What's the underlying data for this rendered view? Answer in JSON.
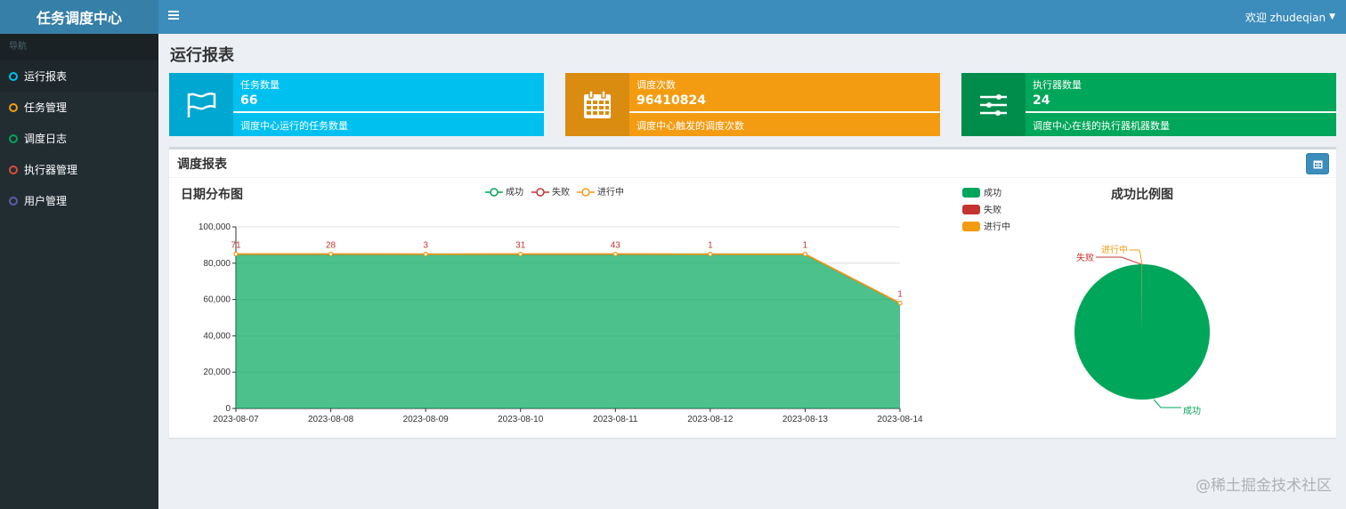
{
  "header": {
    "brand": "任务调度中心",
    "user": "欢迎 zhudeqian"
  },
  "sidebar": {
    "header": "导航",
    "items": [
      {
        "label": "运行报表",
        "color": "#00c0ef"
      },
      {
        "label": "任务管理",
        "color": "#f39c12"
      },
      {
        "label": "调度日志",
        "color": "#00a65a"
      },
      {
        "label": "执行器管理",
        "color": "#dd4b39"
      },
      {
        "label": "用户管理",
        "color": "#605ca8"
      }
    ]
  },
  "page": {
    "title": "运行报表"
  },
  "info_boxes": [
    {
      "title": "任务数量",
      "number": "66",
      "desc": "调度中心运行的任务数量",
      "color": "#00c0ef",
      "icon_bg": "#00a7d0",
      "icon": "flag-icon"
    },
    {
      "title": "调度次数",
      "number": "96410824",
      "desc": "调度中心触发的调度次数",
      "color": "#f39c12",
      "icon_bg": "#da8c10",
      "icon": "calendar-icon"
    },
    {
      "title": "执行器数量",
      "number": "24",
      "desc": "调度中心在线的执行器机器数量",
      "color": "#00a65a",
      "icon_bg": "#008d4c",
      "icon": "sliders-icon"
    }
  ],
  "report": {
    "title": "调度报表"
  },
  "line_chart": {
    "title": "日期分布图",
    "legend": [
      "成功",
      "失败",
      "进行中"
    ]
  },
  "pie_chart": {
    "title": "成功比例图",
    "legend": [
      "成功",
      "失败",
      "进行中"
    ]
  },
  "chart_data": [
    {
      "type": "area",
      "title": "日期分布图",
      "categories": [
        "2023-08-07",
        "2023-08-08",
        "2023-08-09",
        "2023-08-10",
        "2023-08-11",
        "2023-08-12",
        "2023-08-13",
        "2023-08-14"
      ],
      "y_ticks": [
        "0",
        "20,000",
        "40,000",
        "60,000",
        "80,000",
        "100,000"
      ],
      "ylim": [
        0,
        100000
      ],
      "stacked": true,
      "series": [
        {
          "name": "成功",
          "color": "#00a65a",
          "values": [
            85000,
            85000,
            85000,
            85000,
            85000,
            85000,
            85000,
            58000
          ]
        },
        {
          "name": "失败",
          "color": "#c23531",
          "values": [
            71,
            28,
            3,
            31,
            43,
            1,
            1,
            1
          ]
        },
        {
          "name": "进行中",
          "color": "#f39c12",
          "values": [
            0,
            0,
            0,
            0,
            0,
            0,
            0,
            0
          ]
        }
      ],
      "legend_position": "top"
    },
    {
      "type": "pie",
      "title": "成功比例图",
      "labels": [
        "成功",
        "失败",
        "进行中"
      ],
      "values": [
        99.9,
        0.05,
        0.05
      ],
      "colors": [
        "#00a65a",
        "#c23531",
        "#f39c12"
      ],
      "legend_position": "left"
    }
  ],
  "watermark": "@稀土掘金技术社区"
}
